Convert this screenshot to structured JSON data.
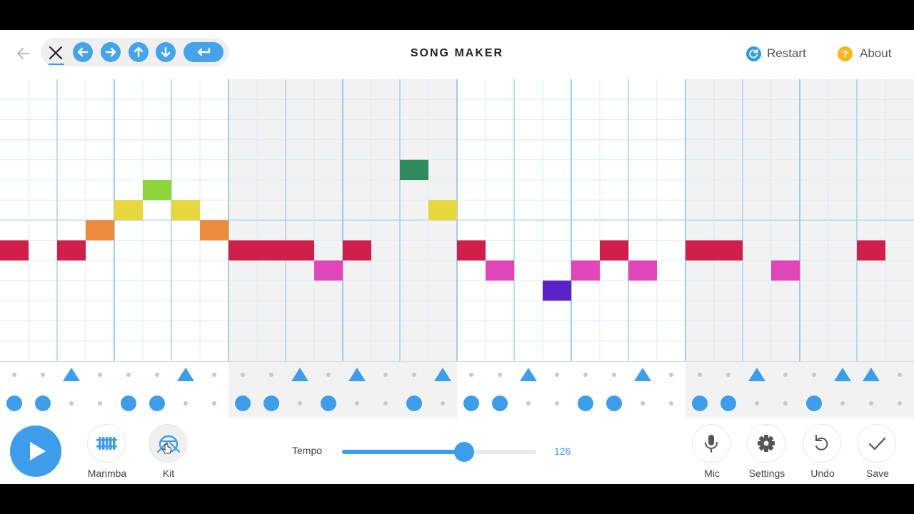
{
  "header": {
    "title": "SONG MAKER",
    "restart_label": "Restart",
    "about_label": "About",
    "about_icon_text": "?",
    "icons": [
      "back-arrow-icon",
      "close-icon",
      "arrow-left-icon",
      "arrow-right-icon",
      "arrow-up-icon",
      "arrow-down-icon",
      "enter-icon",
      "restart-icon",
      "help-icon"
    ]
  },
  "footer": {
    "instrument_label": "Marimba",
    "percussion_label": "Kit",
    "tempo_label": "Tempo",
    "tempo_value": "126",
    "tempo_fraction": 0.63,
    "mic_label": "Mic",
    "settings_label": "Settings",
    "undo_label": "Undo",
    "save_label": "Save"
  },
  "grid": {
    "columns": 32,
    "rows": 14,
    "beats_per_bar": 2,
    "subdivisions_per_beat": 2,
    "shaded_bars": [
      2,
      3,
      6,
      7
    ]
  },
  "colors": {
    "accent": "#3e9deb",
    "restart_icon": "#2b9ce8",
    "about_icon": "#f6b81c",
    "shade": "#f2f2f2",
    "row_colors": {
      "4": "#2f8a5e",
      "5": "#8dd43c",
      "6": "#e7d63c",
      "7": "#ec8b3a",
      "8": "#d11f4b",
      "9": "#e046b8",
      "10": "#5a22c7"
    }
  },
  "notes": [
    {
      "col": 0,
      "row": 8
    },
    {
      "col": 2,
      "row": 8
    },
    {
      "col": 3,
      "row": 7
    },
    {
      "col": 4,
      "row": 6
    },
    {
      "col": 5,
      "row": 5
    },
    {
      "col": 6,
      "row": 6
    },
    {
      "col": 7,
      "row": 7
    },
    {
      "col": 8,
      "row": 8
    },
    {
      "col": 9,
      "row": 8
    },
    {
      "col": 10,
      "row": 8
    },
    {
      "col": 11,
      "row": 9
    },
    {
      "col": 12,
      "row": 8
    },
    {
      "col": 14,
      "row": 4
    },
    {
      "col": 15,
      "row": 6
    },
    {
      "col": 16,
      "row": 8
    },
    {
      "col": 17,
      "row": 9
    },
    {
      "col": 19,
      "row": 10
    },
    {
      "col": 20,
      "row": 9
    },
    {
      "col": 21,
      "row": 8
    },
    {
      "col": 22,
      "row": 9
    },
    {
      "col": 24,
      "row": 8
    },
    {
      "col": 25,
      "row": 8
    },
    {
      "col": 27,
      "row": 9
    },
    {
      "col": 30,
      "row": 8
    }
  ],
  "drums": {
    "triangle_cols": [
      2,
      6,
      10,
      12,
      15,
      18,
      22,
      26,
      29,
      30
    ],
    "circle_cols": [
      0,
      1,
      4,
      5,
      8,
      9,
      11,
      14,
      16,
      17,
      20,
      21,
      24,
      25,
      28
    ]
  }
}
